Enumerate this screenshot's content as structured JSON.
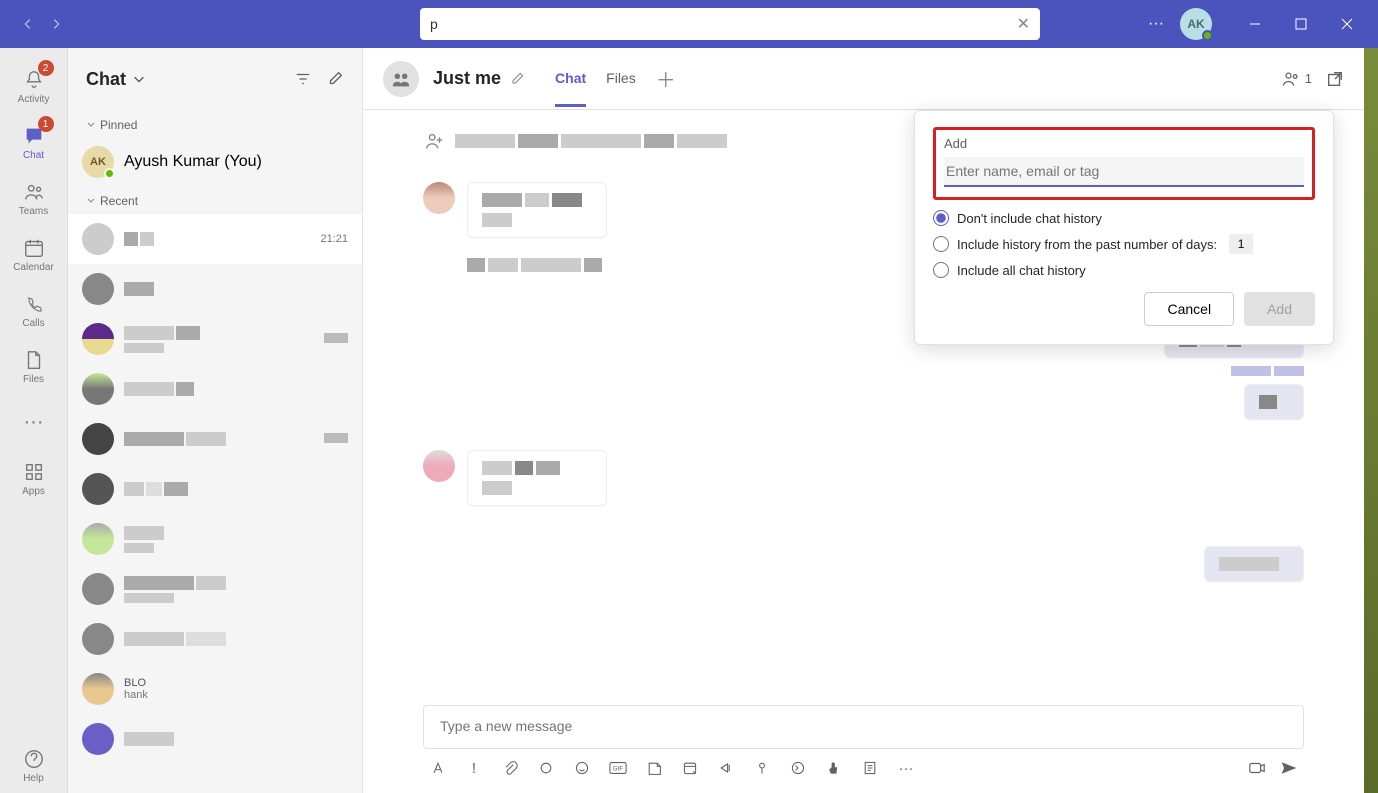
{
  "title_bar": {
    "search_value": "p",
    "avatar_initials": "AK"
  },
  "rail": {
    "items": [
      {
        "key": "activity",
        "label": "Activity",
        "badge": "2"
      },
      {
        "key": "chat",
        "label": "Chat",
        "badge": "1"
      },
      {
        "key": "teams",
        "label": "Teams"
      },
      {
        "key": "calendar",
        "label": "Calendar"
      },
      {
        "key": "calls",
        "label": "Calls"
      },
      {
        "key": "files",
        "label": "Files"
      }
    ],
    "apps_label": "Apps",
    "help_label": "Help"
  },
  "chat_panel": {
    "title": "Chat",
    "pinned_label": "Pinned",
    "recent_label": "Recent",
    "pinned_user": "Ayush Kumar (You)",
    "pinned_initials": "AK",
    "selected_time": "21:21"
  },
  "chat_header": {
    "title": "Just me",
    "tabs": {
      "chat": "Chat",
      "files": "Files"
    },
    "participant_count": "1"
  },
  "compose": {
    "placeholder": "Type a new message"
  },
  "popover": {
    "title": "Add",
    "input_placeholder": "Enter name, email or tag",
    "opt_none": "Don't include chat history",
    "opt_days": "Include history from the past number of days:",
    "opt_all": "Include all chat history",
    "days_value": "1",
    "cancel": "Cancel",
    "add": "Add"
  }
}
